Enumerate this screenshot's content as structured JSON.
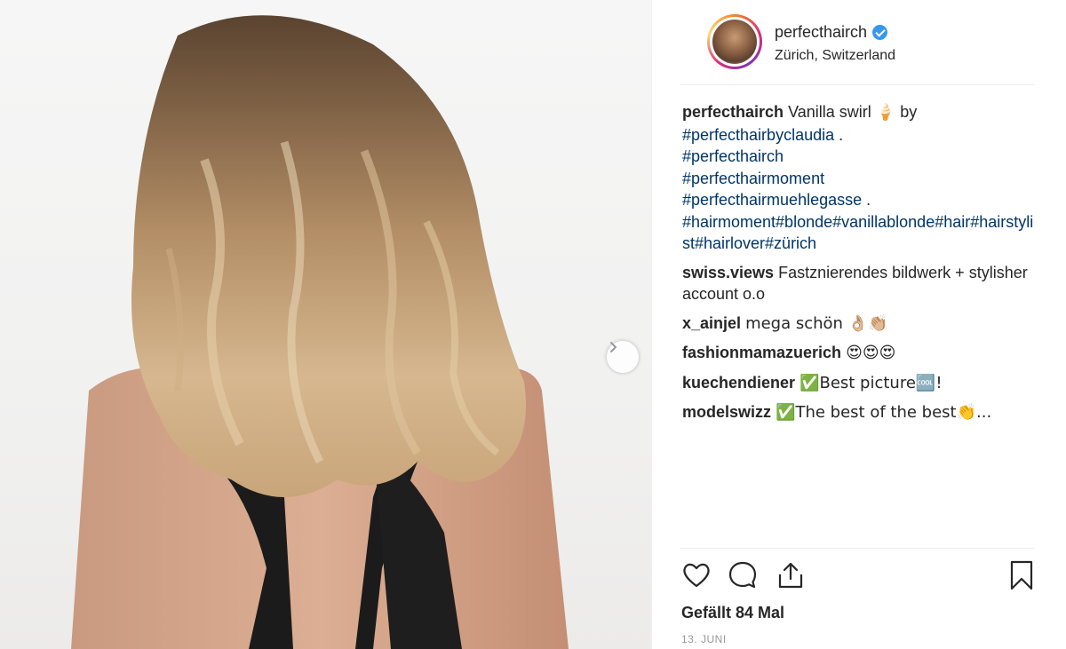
{
  "post": {
    "image_alt": "",
    "next_icon": "chevron-right-icon"
  },
  "header": {
    "username": "perfecthairch",
    "verified_icon": "verified-badge-icon",
    "location": "Zürich, Switzerland"
  },
  "caption": {
    "username": "perfecthairch",
    "text": "Vanilla swirl",
    "emoji": "🍦",
    "by": "by",
    "line1_tag": "#perfecthairbyclaudia",
    "line1_tail": " .",
    "line2_tag": "#perfecthairch",
    "line3_tag": "#perfecthairmoment",
    "line4_tag": "#perfecthairmuehlegasse",
    "line4_tail": " .",
    "line5": "#hairmoment#blonde#vanillablonde#hair#hairstylist#hairlover#zürich"
  },
  "comments": [
    {
      "user": "swiss.views",
      "text": "Fastznierendes bildwerk + stylisher account o.o"
    },
    {
      "user": "x_ainjel",
      "text": "mega schön 👌🏼👏🏼"
    },
    {
      "user": "fashionmamazuerich",
      "text": "😍😍😍"
    },
    {
      "user": "kuechendiener",
      "text": "✅Best picture🆒!"
    },
    {
      "user": "modelswizz",
      "text": "✅The best of the best👏..."
    }
  ],
  "actions": {
    "like_icon": "heart-icon",
    "comment_icon": "comment-bubble-icon",
    "share_icon": "share-icon",
    "save_icon": "bookmark-icon"
  },
  "likes_text": "Gefällt 84 Mal",
  "date": "13. JUNI",
  "colors": {
    "hashtag": "#003569",
    "verified": "#3897f0",
    "text": "#262626",
    "muted": "#999999"
  }
}
